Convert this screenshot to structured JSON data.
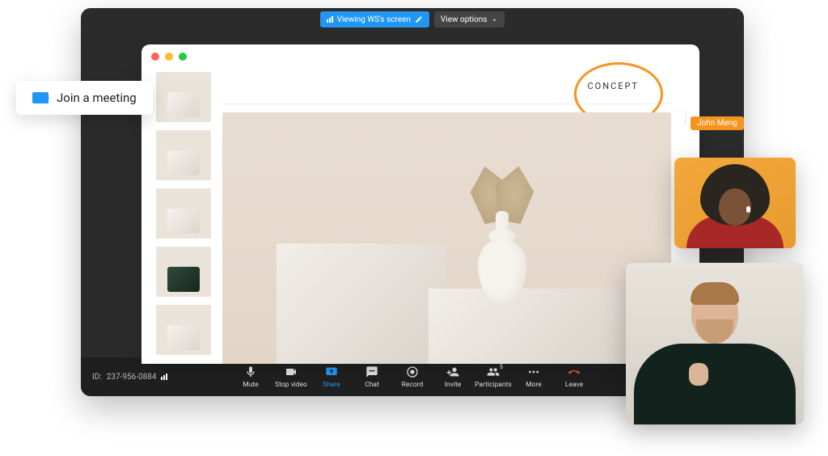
{
  "top": {
    "viewing_label": "Viewing WS's screen",
    "view_options_label": "View options"
  },
  "shared": {
    "concept_label": "CONCEPT"
  },
  "cursor": {
    "name": "John Meng"
  },
  "meeting": {
    "id_prefix": "ID:",
    "id": "237-956-0884"
  },
  "controls": {
    "mute": "Mute",
    "stop_video": "Stop video",
    "share": "Share",
    "chat": "Chat",
    "record": "Record",
    "invite": "Invite",
    "participants": "Participants",
    "participants_count": "5",
    "more": "More",
    "leave": "Leave"
  },
  "overlay": {
    "join_label": "Join a meeting"
  }
}
